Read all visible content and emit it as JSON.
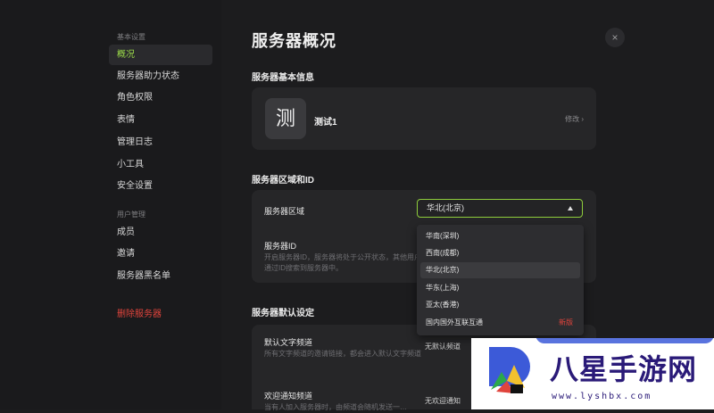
{
  "nav": {
    "section_basic": "基本设置",
    "items_basic": [
      "概况",
      "服务器助力状态",
      "角色权限",
      "表情",
      "管理日志",
      "小工具",
      "安全设置"
    ],
    "section_users": "用户管理",
    "items_users": [
      "成员",
      "邀请",
      "服务器黑名单"
    ],
    "delete_label": "删除服务器"
  },
  "page": {
    "title": "服务器概况",
    "close_glyph": "×"
  },
  "basic_info": {
    "section_title": "服务器基本信息",
    "avatar_char": "测",
    "server_name": "测试1",
    "edit_label": "修改 ›"
  },
  "region": {
    "section_title": "服务器区域和ID",
    "region_label": "服务器区域",
    "selected_region": "华北(北京)",
    "id_label": "服务器ID",
    "id_desc": "开启服务器ID，服务器将处于公开状态，其他用户可通过ID搜索到服务器中。",
    "options": [
      "华南(深圳)",
      "西南(成都)",
      "华北(北京)",
      "华东(上海)",
      "亚太(香港)",
      "国内国外互联互通"
    ],
    "options_badge": "新版"
  },
  "defaults": {
    "section_title": "服务器默认设定",
    "text_channel_label": "默认文字频道",
    "text_channel_desc": "所有文字频道的邀请链接，都会进入默认文字频道",
    "text_channel_value": "无默认频道",
    "welcome_label": "欢迎通知频道",
    "welcome_desc": "当有人加入服务器时，由频道会随机发送一…",
    "welcome_value": "无欢迎通知"
  },
  "watermark": {
    "brand": "八星手游网",
    "url": "www.lyshbx.com"
  },
  "colors": {
    "accent": "#8fce3c",
    "danger": "#e0443c",
    "background": "#1c1c1e",
    "card": "#262628"
  }
}
